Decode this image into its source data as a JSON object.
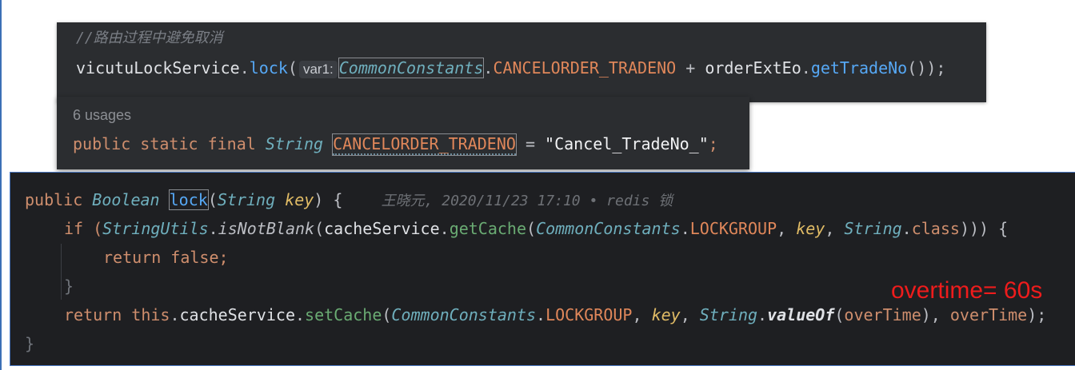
{
  "snippet1": {
    "comment": "//路由过程中避免取消",
    "obj": "vicutuLockService",
    "dot1": ".",
    "method": "lock",
    "open": "(",
    "hint": "var1:",
    "cls": "CommonConstants",
    "dot2": ".",
    "const": "CANCELORDER_TRADENO",
    "plus": " + ",
    "obj2": "orderExtEo",
    "dot3": ".",
    "method2": "getTradeNo",
    "tail": "());"
  },
  "snippet2": {
    "usages": "6 usages",
    "kw": "public static final ",
    "type": "String",
    "name": "CANCELORDER_TRADENO",
    "eq": " = ",
    "value": "\"Cancel_TradeNo_\"",
    "semi": ";"
  },
  "snippet3": {
    "l1_public": "public ",
    "l1_type": "Boolean",
    "l1_name": "lock",
    "l1_open": "(",
    "l1_ptype": "String",
    "l1_param": " key",
    "l1_close": ") {",
    "blame": "王晓元, 2020/11/23 17:10 • redis 锁",
    "l2_if": "if (",
    "l2_cls": "StringUtils",
    "l2_dot": ".",
    "l2_m": "isNotBlank",
    "l2_o": "(",
    "l2_svc": "cacheService",
    "l2_dot2": ".",
    "l2_get": "getCache",
    "l2_o2": "(",
    "l2_cc": "CommonConstants",
    "l2_dot3": ".",
    "l2_lg": "LOCKGROUP",
    "l2_c1": ", ",
    "l2_key": "key",
    "l2_c2": ", ",
    "l2_str": "String",
    "l2_dot4": ".",
    "l2_class": "class",
    "l2_end": "))) {",
    "l3": "return false;",
    "l4": "}",
    "l5_ret": "return this",
    "l5_dot": ".",
    "l5_svc": "cacheService",
    "l5_dot2": ".",
    "l5_set": "setCache",
    "l5_o": "(",
    "l5_cc": "CommonConstants",
    "l5_dot3": ".",
    "l5_lg": "LOCKGROUP",
    "l5_c1": ", ",
    "l5_key": "key",
    "l5_c2": ", ",
    "l5_str": "String",
    "l5_dot4": ".",
    "l5_vo": "valueOf",
    "l5_o2": "(",
    "l5_ot": "overTime",
    "l5_c3": "), ",
    "l5_ot2": "overTime",
    "l5_end": ");",
    "l6": "}"
  },
  "annotation": "overtime= 60s"
}
